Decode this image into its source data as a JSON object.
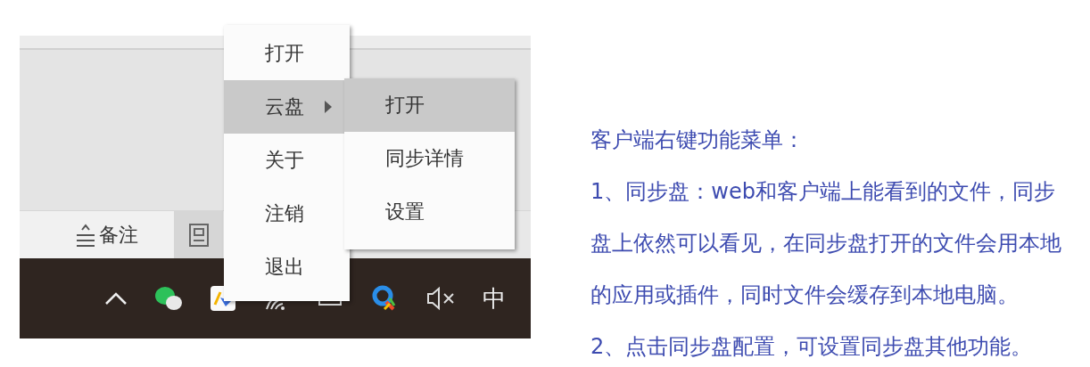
{
  "screenshot": {
    "note_tab": "备注",
    "ime": "中",
    "menu": [
      {
        "label": "打开",
        "selected": false,
        "has_submenu": false
      },
      {
        "label": "云盘",
        "selected": true,
        "has_submenu": true
      },
      {
        "label": "关于",
        "selected": false,
        "has_submenu": false
      },
      {
        "label": "注销",
        "selected": false,
        "has_submenu": false
      },
      {
        "label": "退出",
        "selected": false,
        "has_submenu": false
      }
    ],
    "submenu": [
      {
        "label": "打开",
        "selected": true
      },
      {
        "label": "同步详情",
        "selected": false
      },
      {
        "label": "设置",
        "selected": false
      }
    ]
  },
  "description": {
    "title": "客户端右键功能菜单：",
    "items": [
      "1、同步盘：web和客户端上能看到的文件，同步盘上依然可以看见，在同步盘打开的文件会用本地的应用或插件，同时文件会缓存到本地电脑。",
      "2、点击同步盘配置，可设置同步盘其他功能。"
    ]
  }
}
